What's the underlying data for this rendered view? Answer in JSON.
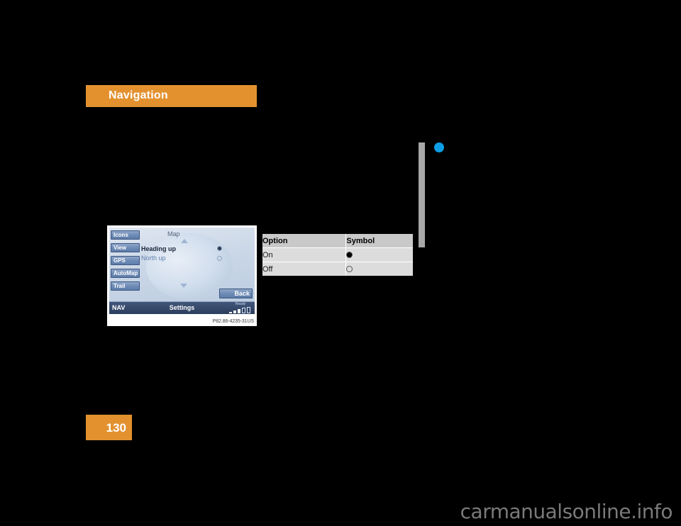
{
  "page": {
    "chapter_title": "Navigation",
    "page_number": "130",
    "watermark": "carmanualsonline.info",
    "colors": {
      "accent_orange": "#e3912f",
      "marker_blue": "#0d9ee5",
      "margin_gray": "#a8a8a8"
    }
  },
  "figure": {
    "caption": "P82.86-4235-31US",
    "screen": {
      "title": "Map",
      "side_buttons": [
        {
          "label": "Icons"
        },
        {
          "label": "View"
        },
        {
          "label": "GPS"
        },
        {
          "label": "AutoMap"
        },
        {
          "label": "Trail"
        }
      ],
      "options": [
        {
          "label": "Heading up",
          "selected": true
        },
        {
          "label": "North up",
          "selected": false
        }
      ],
      "back_button": "Back",
      "status_bar": {
        "mode": "NAV",
        "screen_name": "Settings",
        "signal_label": "Ready"
      },
      "scroll_up_icon": "triangle-up-icon",
      "scroll_down_icon": "triangle-down-icon"
    }
  },
  "option_table": {
    "columns": [
      "Option",
      "Symbol"
    ],
    "rows": [
      {
        "option": "On",
        "symbol": "radio-filled-icon"
      },
      {
        "option": "Off",
        "symbol": "radio-empty-icon"
      }
    ]
  }
}
